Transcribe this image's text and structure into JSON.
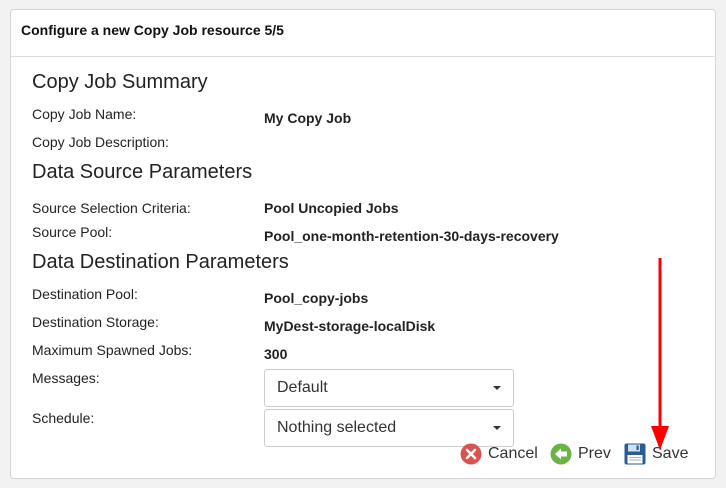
{
  "dialog": {
    "title": "Configure a new Copy Job resource 5/5"
  },
  "sections": {
    "summary": {
      "title": "Copy Job Summary",
      "name_label": "Copy Job Name:",
      "name_value": "My Copy Job",
      "description_label": "Copy Job Description:"
    },
    "source": {
      "title": "Data Source Parameters",
      "criteria_label": "Source Selection Criteria:",
      "criteria_value": "Pool Uncopied Jobs",
      "pool_label": "Source Pool:",
      "pool_value": "Pool_one-month-retention-30-days-recovery"
    },
    "destination": {
      "title": "Data Destination Parameters",
      "pool_label": "Destination Pool:",
      "pool_value": "Pool_copy-jobs",
      "storage_label": "Destination Storage:",
      "storage_value": "MyDest-storage-localDisk",
      "max_jobs_label": "Maximum Spawned Jobs:",
      "max_jobs_value": "300",
      "messages_label": "Messages:",
      "messages_value": "Default",
      "schedule_label": "Schedule:",
      "schedule_value": "Nothing selected"
    }
  },
  "footer": {
    "cancel_label": "Cancel",
    "prev_label": "Prev",
    "save_label": "Save"
  },
  "icons": {
    "cancel": "cancel-icon",
    "prev": "prev-icon",
    "save": "save-icon",
    "annotation": "red-down-arrow"
  },
  "colors": {
    "cancel": "#d9534f",
    "prev": "#6ab344",
    "save": "#2a5d8f",
    "annotation_arrow": "#ff0000"
  }
}
